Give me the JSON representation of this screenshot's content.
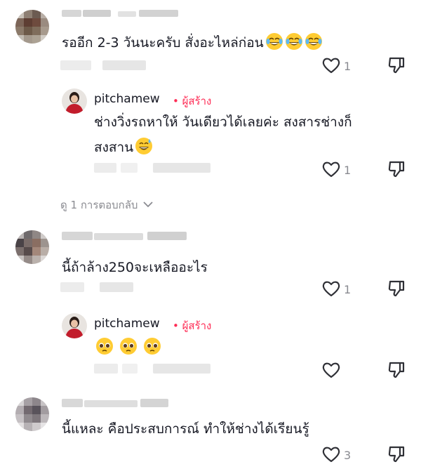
{
  "comments": [
    {
      "text": "รออีก 2-3 วันนะครับ สั่งอะไหล่ก่อน",
      "emoji_1": "face-with-tears-of-joy",
      "likes": "1",
      "reply": {
        "user": "pitchamew",
        "tag": "• ผู้สร้าง",
        "line_1": "ช่างวิ่งรถหาให้ วันเดียวได้เลยค่ะ สงสารช่างก็",
        "line_2": "สงสาน",
        "emoji": "grinning-face-with-sweat",
        "likes": "1"
      },
      "view_replies": "ดู 1 การตอบกลับ"
    },
    {
      "text": "นี้ถ้าล้าง250จะเหลืออะไร",
      "likes": "1",
      "reply": {
        "user": "pitchamew",
        "tag": "• ผู้สร้าง",
        "emoji": "pleading-face"
      }
    },
    {
      "text": "นี้แหละ คือประสบการณ์  ทำให้ช่างได้เรียนรู้",
      "likes": "3"
    }
  ],
  "colors": {
    "creator_tag": "#fe2c55",
    "muted": "#8a8b91",
    "text": "#161823"
  }
}
